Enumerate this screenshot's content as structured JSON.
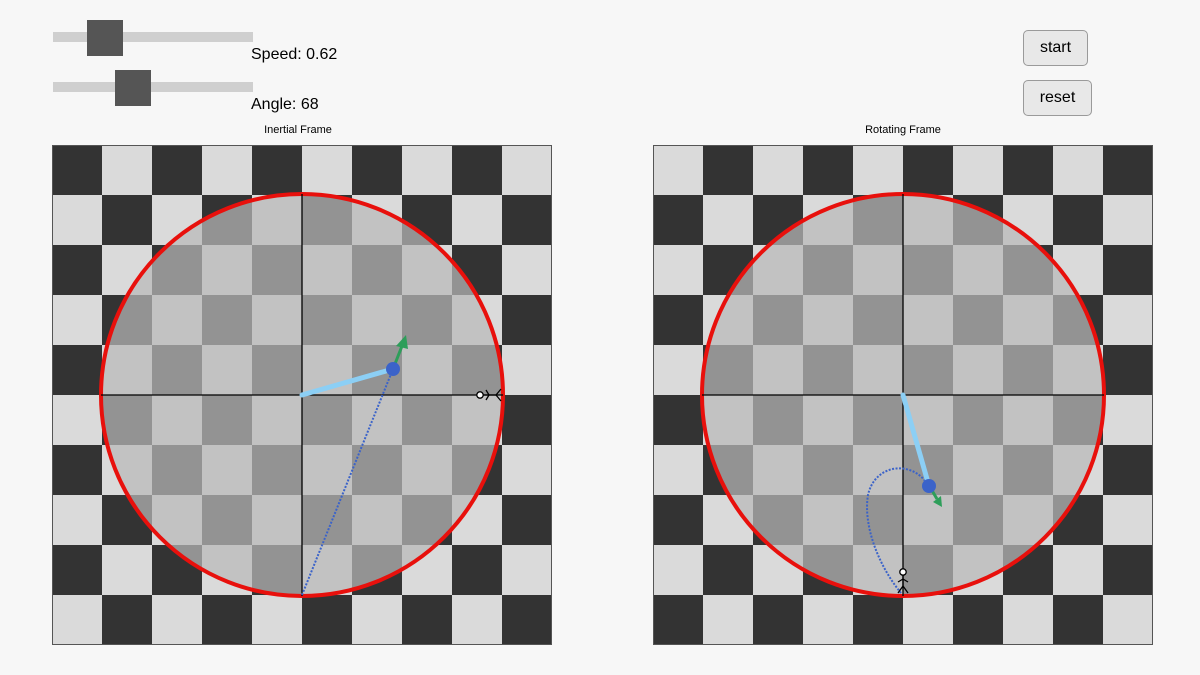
{
  "controls": {
    "speed": {
      "label": "Speed: 0.62",
      "value": 0.62
    },
    "angle": {
      "label": "Angle: 68",
      "value": 68
    },
    "start_label": "start",
    "reset_label": "reset"
  },
  "frames": {
    "inertial": {
      "title": "Inertial Frame"
    },
    "rotating": {
      "title": "Rotating Frame"
    }
  },
  "colors": {
    "dark_square": "#333333",
    "light_square": "#dadada",
    "disk_rim": "#e8100c",
    "position_vector": "#8ccff5",
    "ball": "#3b63c9",
    "trajectory": "#3b63c9",
    "velocity_arrow": "#2e9e5a"
  }
}
